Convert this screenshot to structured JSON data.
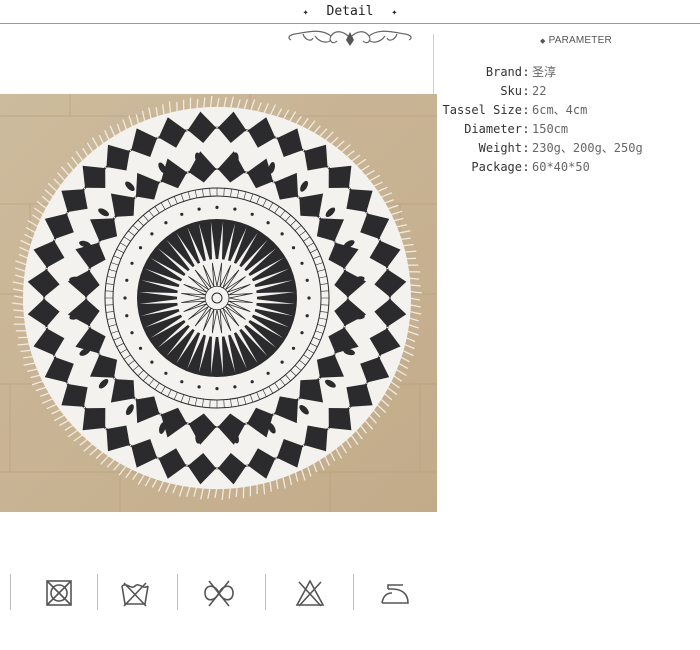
{
  "header": {
    "title": "Detail",
    "star_left": "✦",
    "star_right": "✦"
  },
  "parameter": {
    "heading": "PARAMETER",
    "heading_dot": "◆",
    "rows": [
      {
        "label": "Brand",
        "sep": ":",
        "value": "圣淳"
      },
      {
        "label": "Sku",
        "sep": ":",
        "value": "22"
      },
      {
        "label": "Tassel Size",
        "sep": ":",
        "value": "6cm、4cm"
      },
      {
        "label": "Diameter",
        "sep": ":",
        "value": "150cm"
      },
      {
        "label": "Weight",
        "sep": ":",
        "value": "230g、200g、250g"
      },
      {
        "label": "Package",
        "sep": ":",
        "value": "60*40*50"
      }
    ]
  },
  "care_icons": [
    "do-not-tumble-dry-icon",
    "do-not-bleach-icon",
    "do-not-wring-icon",
    "do-not-bleach-triangle-icon",
    "iron-icon"
  ],
  "colors": {
    "pattern_dark": "#2b2b2e",
    "floor": "#c9b597",
    "line": "#9a9a9a"
  }
}
